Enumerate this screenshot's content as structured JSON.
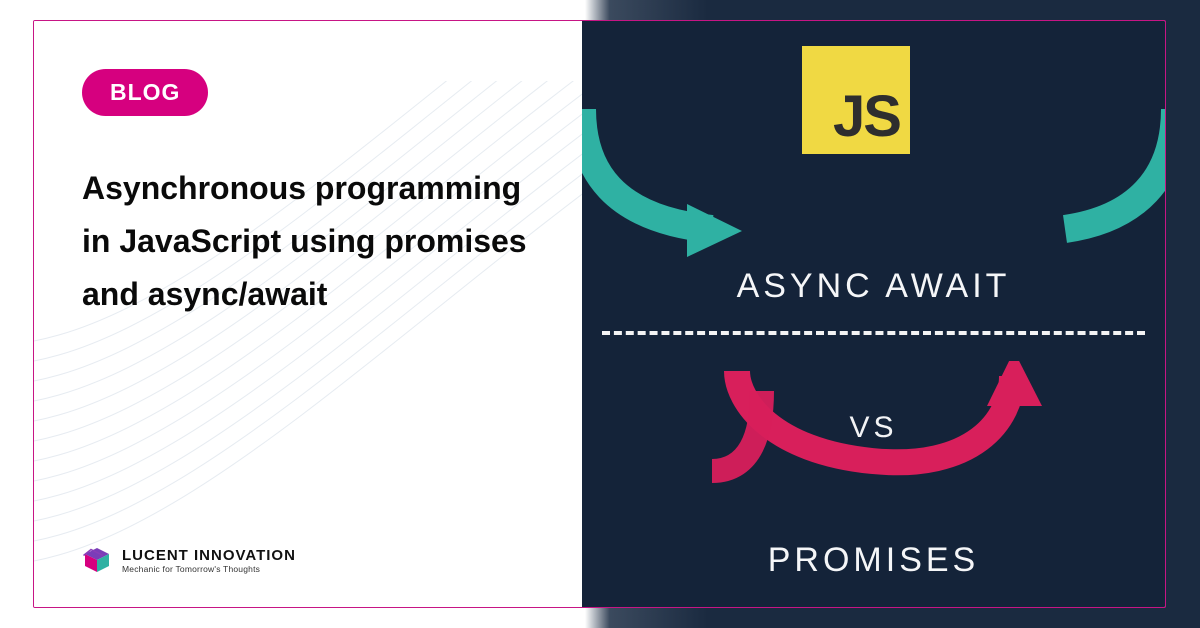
{
  "badge_label": "BLOG",
  "headline": " Asynchronous programming in JavaScript using promises and async/await",
  "brand": {
    "name": "LUCENT INNOVATION",
    "tagline": "Mechanic for Tomorrow's Thoughts"
  },
  "illustration": {
    "lang_badge": "JS",
    "top_label": "ASYNC AWAIT",
    "mid_label": "VS",
    "bottom_label": "PROMISES"
  },
  "colors": {
    "accent": "#d6007f",
    "js_yellow": "#f0d943",
    "navy": "#142339",
    "teal": "#2fb1a3",
    "magenta": "#d81f5b"
  }
}
